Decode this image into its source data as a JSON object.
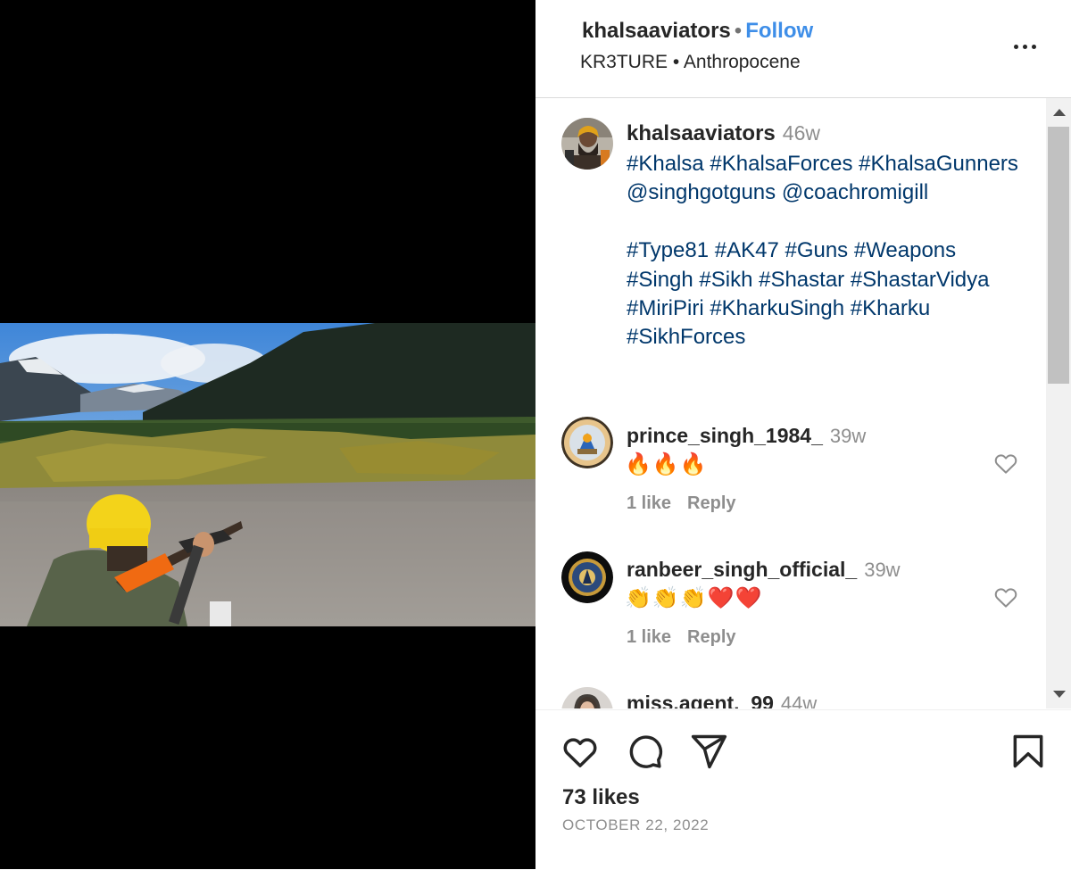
{
  "header": {
    "username": "khalsaaviators",
    "separator": "•",
    "follow_label": "Follow",
    "audio": "KR3TURE • Anthropocene"
  },
  "caption": {
    "username": "khalsaaviators",
    "time": "46w",
    "text": "#Khalsa #KhalsaForces #KhalsaGunners\n@singhgotguns @coachromigill\n\n#Type81 #AK47 #Guns #Weapons\n#Singh #Sikh #Shastar #ShastarVidya\n#MiriPiri #KharkuSingh #Kharku\n#SikhForces"
  },
  "comments": [
    {
      "username": "prince_singh_1984_",
      "time": "39w",
      "text": "🔥🔥🔥",
      "likes": "1 like",
      "reply_label": "Reply"
    },
    {
      "username": "ranbeer_singh_official_",
      "time": "39w",
      "text": "👏👏👏❤️❤️",
      "likes": "1 like",
      "reply_label": "Reply"
    },
    {
      "username": "miss.agent._99",
      "time": "44w"
    }
  ],
  "footer": {
    "likes": "73 likes",
    "date": "OCTOBER 22, 2022"
  },
  "icons": {
    "like": "heart-icon",
    "comment": "comment-icon",
    "share": "paper-plane-icon",
    "save": "bookmark-icon",
    "more": "more-options-icon"
  },
  "colors": {
    "follow": "#3e8ee8",
    "hashtag": "#00376b",
    "muted": "#8e8e8e"
  }
}
